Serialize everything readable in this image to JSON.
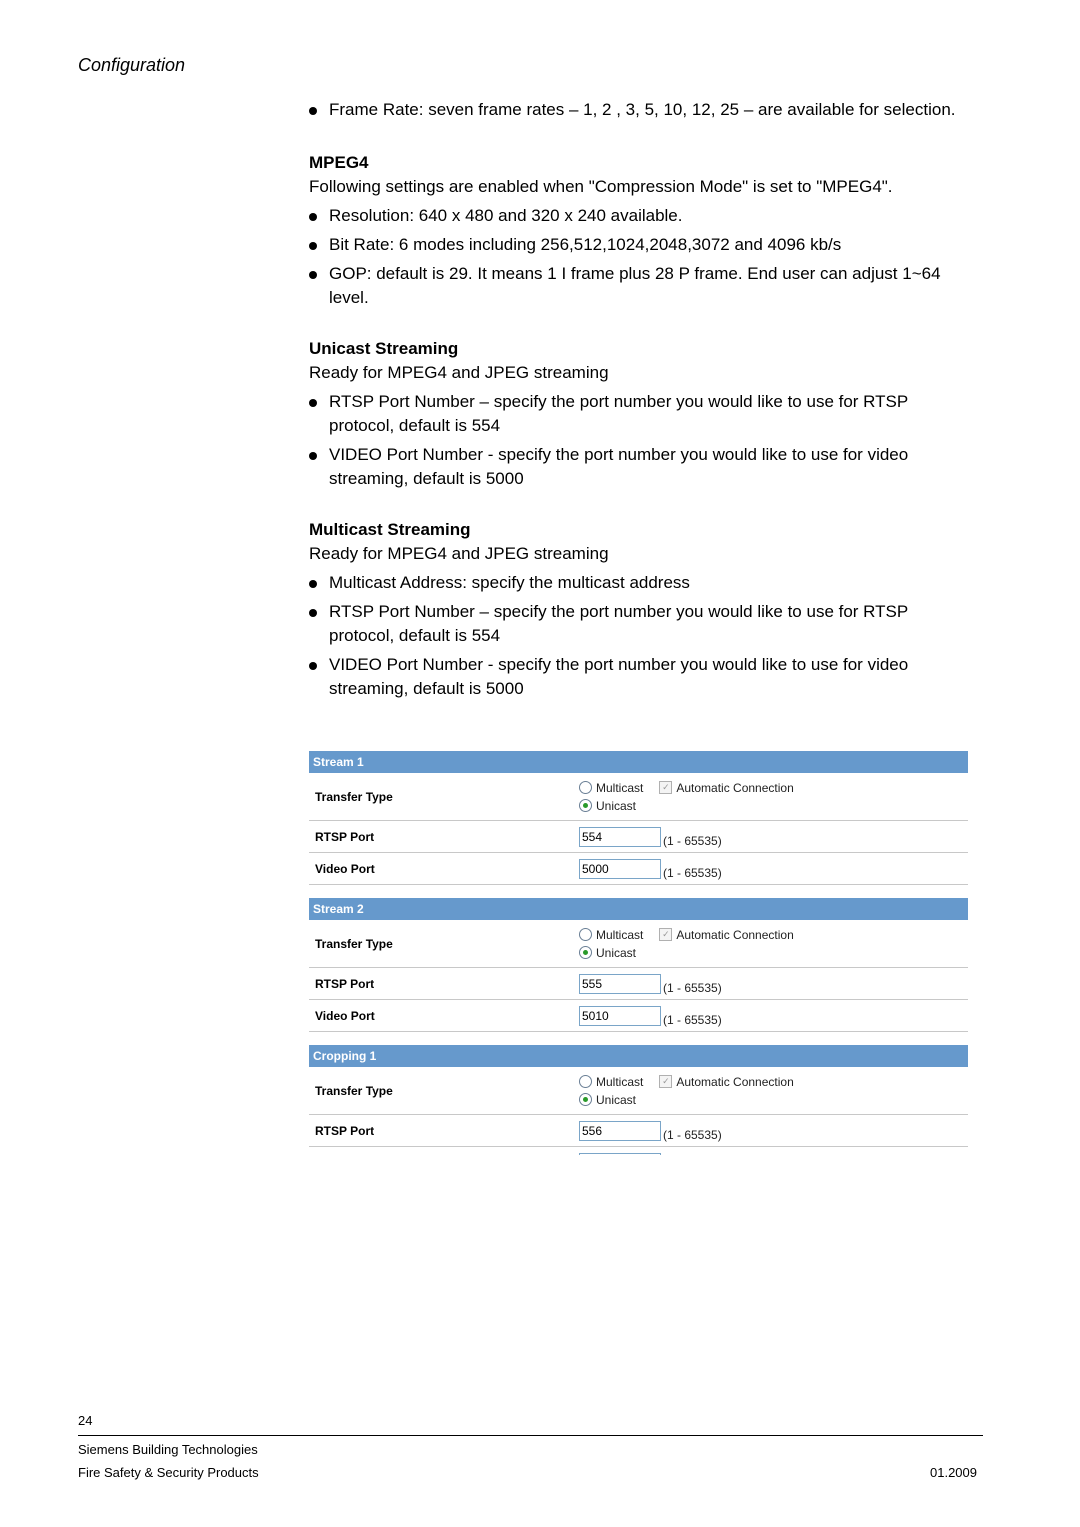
{
  "header": {
    "section": "Configuration"
  },
  "intro_bullets": [
    "Frame Rate: seven frame rates – 1, 2 , 3, 5, 10, 12, 25 – are available for selection."
  ],
  "mpeg4": {
    "heading": "MPEG4",
    "intro": "Following settings are enabled when \"Compression Mode\" is set to \"MPEG4\".",
    "bullets": [
      "Resolution: 640 x 480 and 320 x 240 available.",
      "Bit Rate: 6 modes including 256,512,1024,2048,3072 and 4096 kb/s",
      "GOP: default is 29. It means 1 I frame plus 28 P frame.  End user can adjust 1~64 level."
    ]
  },
  "unicast": {
    "heading": "Unicast Streaming",
    "intro": "Ready for MPEG4 and JPEG streaming",
    "bullets": [
      "RTSP Port Number – specify the port number you would like to use for RTSP protocol, default is 554",
      "VIDEO Port Number - specify the port number you would like to use for video streaming, default is 5000"
    ]
  },
  "multicast": {
    "heading": "Multicast Streaming",
    "intro": "Ready for MPEG4 and JPEG streaming",
    "bullets": [
      "Multicast Address: specify the multicast address",
      "RTSP Port Number – specify the port number you would like to use for RTSP protocol, default is 554",
      "VIDEO Port Number - specify the port number you would like to use for video streaming, default is 5000"
    ]
  },
  "labels": {
    "transfer_type": "Transfer Type",
    "multicast": "Multicast",
    "unicast": "Unicast",
    "auto_connection": "Automatic Connection",
    "rtsp_port": "RTSP Port",
    "video_port": "Video Port",
    "range": "(1 - 65535)"
  },
  "panels": [
    {
      "title": "Stream 1",
      "rtsp_port": "554",
      "video_port": "5000",
      "selected": "Unicast",
      "auto_connection": true
    },
    {
      "title": "Stream 2",
      "rtsp_port": "555",
      "video_port": "5010",
      "selected": "Unicast",
      "auto_connection": true
    },
    {
      "title": "Cropping 1",
      "rtsp_port": "556",
      "selected": "Unicast",
      "auto_connection": true
    }
  ],
  "footer": {
    "page_number": "24",
    "company": "Siemens Building Technologies",
    "division": "Fire Safety & Security Products",
    "date": "01.2009"
  }
}
